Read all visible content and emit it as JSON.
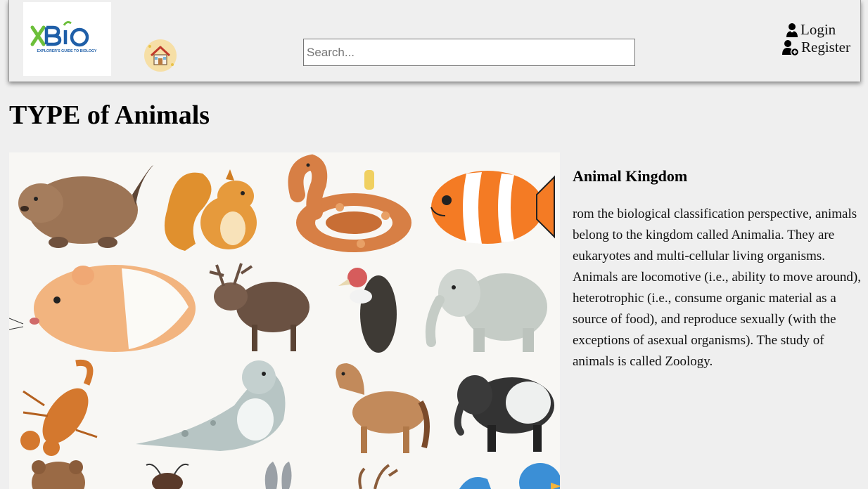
{
  "header": {
    "logo": {
      "brand": "XBIO",
      "tagline": "EXPLORER'S GUIDE TO BIOLOGY",
      "colors": {
        "green": "#6cbf3a",
        "blue": "#1f5fa8"
      }
    },
    "home_icon": "home-icon",
    "search": {
      "placeholder": "Search...",
      "value": ""
    },
    "auth": {
      "login_label": "Login",
      "register_label": "Register",
      "login_icon": "user-icon",
      "register_icon": "user-plus-icon"
    }
  },
  "main": {
    "title": "TYPE of Animals",
    "image": {
      "subject": "animal-illustrations"
    },
    "section": {
      "heading": "Animal Kingdom",
      "body": "rom the biological classification perspective, animals belong to the kingdom called Animalia. They are eukaryotes and multi-cellular living organisms. Animals are locomotive (i.e., ability to move around), heterotrophic (i.e., consume organic material as a source of food), and reproduce sexually (with the exceptions of asexual organisms). The study of animals is called Zoology."
    }
  }
}
